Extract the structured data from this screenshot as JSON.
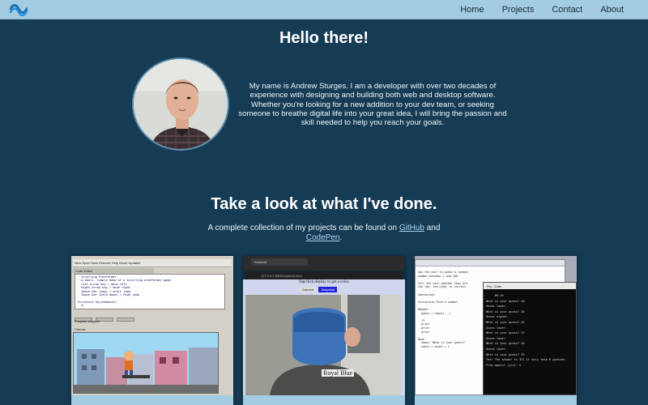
{
  "nav": {
    "logo_icon": "wave-logo-icon",
    "links": [
      "Home",
      "Projects",
      "Contact",
      "About"
    ]
  },
  "hero": {
    "title": "Hello there!",
    "avatar": "profile-photo",
    "bio": "My name is Andrew Sturges. I am a developer with over two decades of experience with designing and building both web and desktop software. Whether you're looking for a new addition to your dev team, or seeking someone to breathe digital life into your great idea, I will bring the passion and skill needed to help you reach your goals."
  },
  "projects": {
    "title": "Take a look at what I've done.",
    "subtitle_before": "A complete collection of my projects can be found on ",
    "github": "GitHub",
    "subtitle_and": " and ",
    "codepen": "CodePen",
    "subtitle_after": ".",
    "cards": [
      {
        "toolbar": "New  Open  Save  Execute  Help  About  Updates",
        "tab": "Code Editor",
        "code": "' Scrolling Platformer\n' A small, simple demo of a scrolling platformer game.\n' Left arrow key = move left\n' Right arrow key = move right\n' Space bar (tap) = short jump\n' Space bar (hold down) = high jump\n\nStructure Spritemaster\n  X\n  Y\n  Frames\n  Delay\nEnd Structure",
        "console_label": "Program stopped",
        "canvas_label": "Canvas"
      },
      {
        "tab_title": "Colorbot",
        "url": "127.0.0.1:5500/colorbot.html",
        "hint": "Tap/click display to get a color.",
        "button_a": "Camera",
        "button_b": "Snapshot",
        "detected_color": "Royal Blue"
      },
      {
        "code": "Ask the user to guess a random\nnumber between 1 and 100\n\nTell the user whether they are\ntoo low, too high, or correct\n\nSubroutine\n\nInitialize Pick a number\n\nRepeat\n  guess = input(...)\n\n  If\n  print\n  print\n  print\n\nDone\n  input \"What is your guess?\"\n  count = count + 1",
        "terminal_title": "Pry - Date",
        "terminal_lines": [
          "     89-10",
          "What is your guess? 40",
          "Guess lower.",
          "What is your guess? 20",
          "Guess higher.",
          "What is your guess? 41",
          "Guess lower.",
          "What is your guess? 37",
          "Guess lower.",
          "What is your guess? 34",
          "Guess lower.",
          "What is your guess? 33",
          "Yes! The answer is 33! It only took 6 guesses.",
          "Play again? (y/n): n"
        ]
      }
    ]
  }
}
